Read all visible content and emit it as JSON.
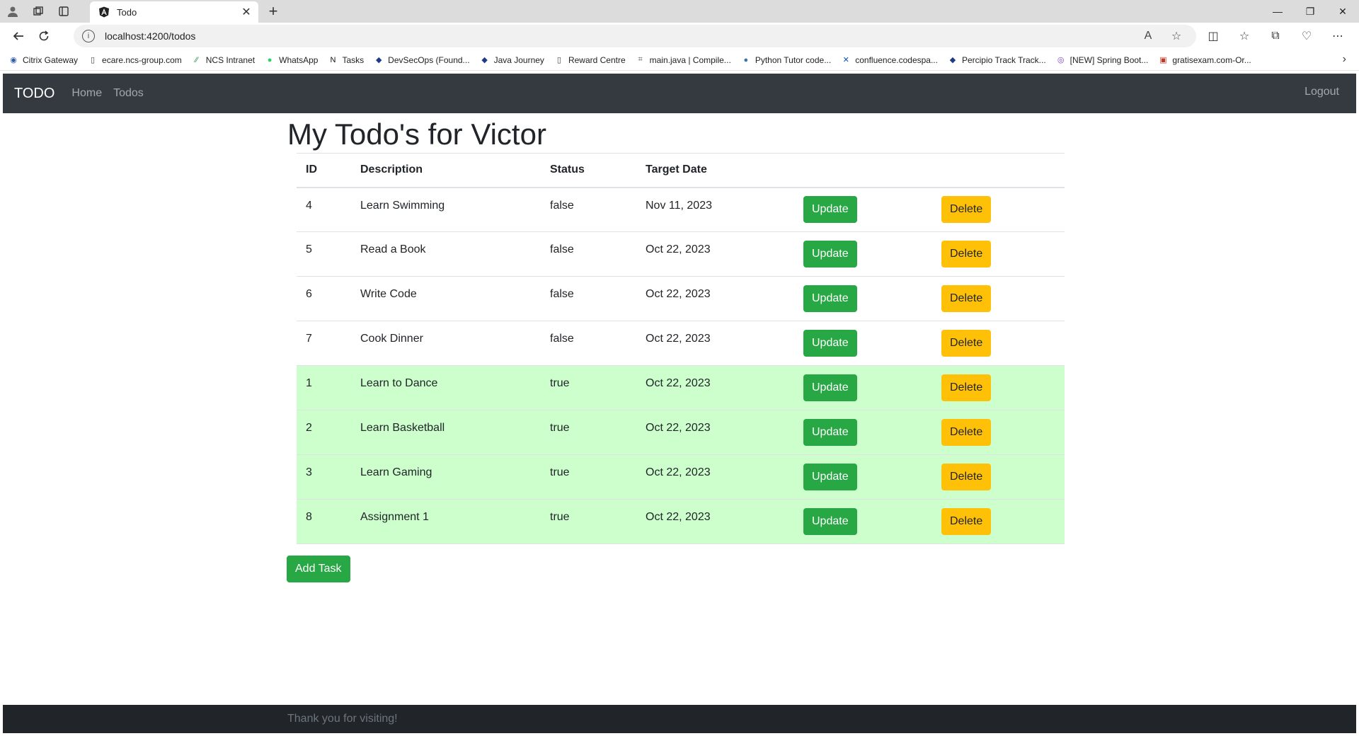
{
  "browser": {
    "tab_title": "Todo",
    "url": "localhost:4200/todos",
    "bookmarks": [
      {
        "label": "Citrix Gateway",
        "icon": "citrix-icon"
      },
      {
        "label": "ecare.ncs-group.com",
        "icon": "page-icon"
      },
      {
        "label": "NCS Intranet",
        "icon": "ncs-icon"
      },
      {
        "label": "WhatsApp",
        "icon": "whatsapp-icon"
      },
      {
        "label": "Tasks",
        "icon": "notion-icon"
      },
      {
        "label": "DevSecOps (Found...",
        "icon": "diamond-icon"
      },
      {
        "label": "Java Journey",
        "icon": "diamond-icon"
      },
      {
        "label": "Reward Centre",
        "icon": "page-icon"
      },
      {
        "label": "main.java | Compile...",
        "icon": "code-icon"
      },
      {
        "label": "Python Tutor code...",
        "icon": "python-icon"
      },
      {
        "label": "confluence.codespa...",
        "icon": "confluence-icon"
      },
      {
        "label": "Percipio Track Track...",
        "icon": "diamond-icon"
      },
      {
        "label": "[NEW] Spring Boot...",
        "icon": "circle-icon"
      },
      {
        "label": "gratisexam.com-Or...",
        "icon": "pdf-icon"
      }
    ]
  },
  "navbar": {
    "brand": "TODO",
    "home": "Home",
    "todos": "Todos",
    "logout": "Logout"
  },
  "page": {
    "title": "My Todo's for Victor"
  },
  "table": {
    "headers": {
      "id": "ID",
      "description": "Description",
      "status": "Status",
      "target_date": "Target Date"
    },
    "update_label": "Update",
    "delete_label": "Delete",
    "rows": [
      {
        "id": "4",
        "description": "Learn Swimming",
        "status": "false",
        "target_date": "Nov 11, 2023",
        "done": false
      },
      {
        "id": "5",
        "description": "Read a Book",
        "status": "false",
        "target_date": "Oct 22, 2023",
        "done": false
      },
      {
        "id": "6",
        "description": "Write Code",
        "status": "false",
        "target_date": "Oct 22, 2023",
        "done": false
      },
      {
        "id": "7",
        "description": "Cook Dinner",
        "status": "false",
        "target_date": "Oct 22, 2023",
        "done": false
      },
      {
        "id": "1",
        "description": "Learn to Dance",
        "status": "true",
        "target_date": "Oct 22, 2023",
        "done": true
      },
      {
        "id": "2",
        "description": "Learn Basketball",
        "status": "true",
        "target_date": "Oct 22, 2023",
        "done": true
      },
      {
        "id": "3",
        "description": "Learn Gaming",
        "status": "true",
        "target_date": "Oct 22, 2023",
        "done": true
      },
      {
        "id": "8",
        "description": "Assignment 1",
        "status": "true",
        "target_date": "Oct 22, 2023",
        "done": true
      }
    ]
  },
  "add_task_label": "Add Task",
  "footer": {
    "text": "Thank you for visiting!"
  },
  "colors": {
    "navbar_bg": "#343a40",
    "footer_bg": "#212529",
    "success": "#28a745",
    "warning": "#ffc107",
    "done_row": "#ccffcc"
  }
}
